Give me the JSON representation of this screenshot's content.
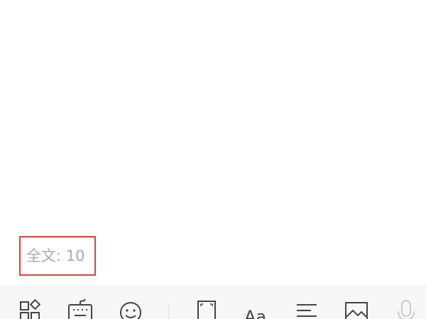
{
  "editor": {
    "word_count_text": "全文: 10"
  },
  "toolbar": {
    "left_group": [
      {
        "icon": "apps-grid-icon"
      },
      {
        "icon": "keyboard-icon"
      },
      {
        "icon": "emoji-icon"
      }
    ],
    "right_group": [
      {
        "icon": "fullscreen-icon"
      },
      {
        "icon": "font-format-icon",
        "glyph": "Aa"
      },
      {
        "icon": "paragraph-align-icon"
      },
      {
        "icon": "image-icon"
      },
      {
        "icon": "voice-mic-icon"
      }
    ]
  },
  "colors": {
    "highlight_border": "#d9443a",
    "word_count_text": "#a9a9a9",
    "toolbar_bg": "#f7f7f7",
    "icon": "#444444",
    "icon_disabled": "#cccccc"
  }
}
